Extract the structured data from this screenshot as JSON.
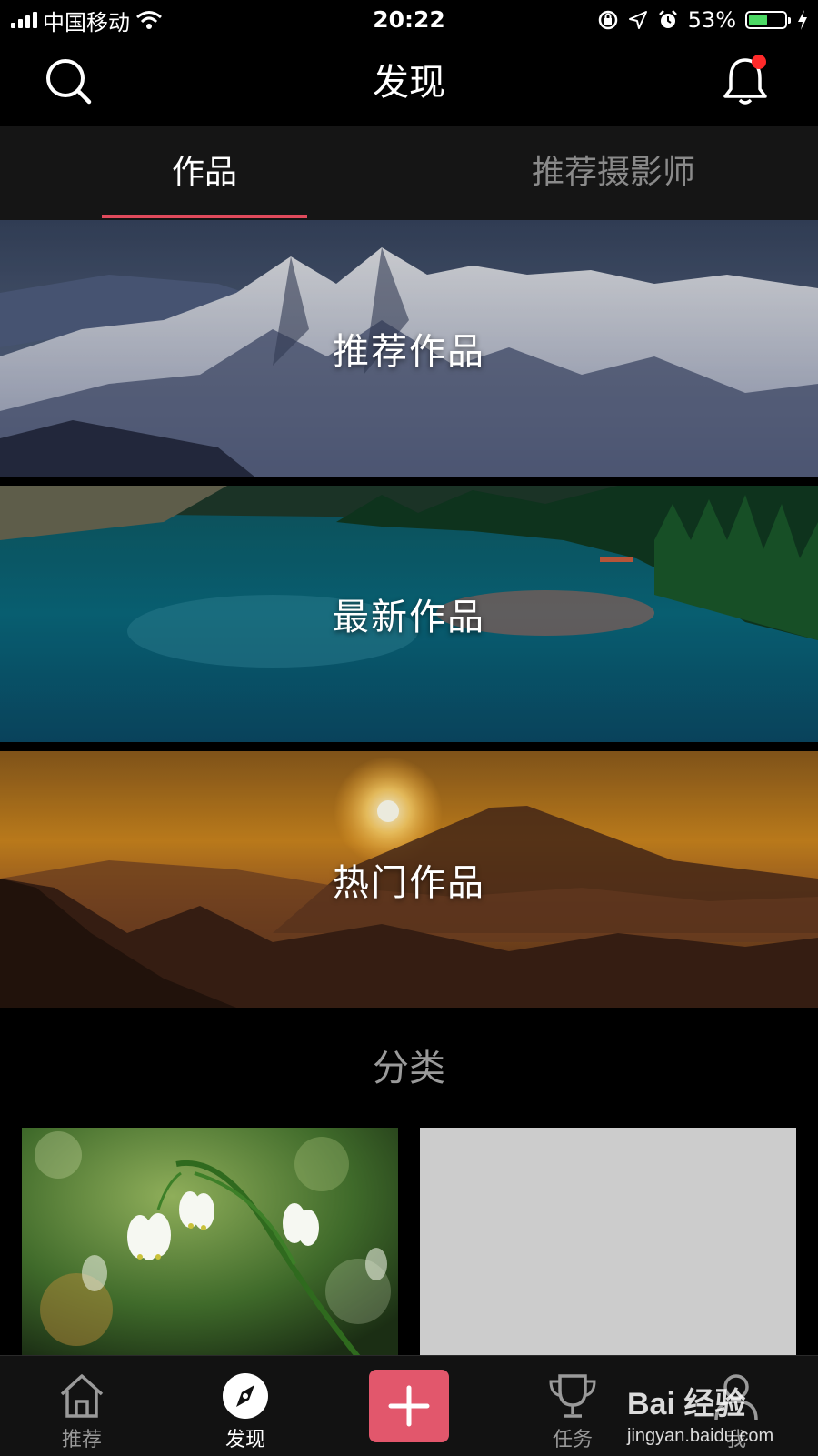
{
  "status_bar": {
    "carrier": "中国移动",
    "time": "20:22",
    "battery_percent": "53%",
    "battery_level": 0.53,
    "icons": [
      "signal-icon",
      "wifi-icon",
      "orientation-lock-icon",
      "location-icon",
      "alarm-icon",
      "battery-icon",
      "charging-icon"
    ]
  },
  "nav": {
    "title": "发现",
    "icons": [
      "search-icon",
      "bell-icon"
    ],
    "notification_dot_color": "#ff2a2a"
  },
  "tabs": [
    {
      "label": "作品",
      "active": true
    },
    {
      "label": "推荐摄影师",
      "active": false
    }
  ],
  "accent_color": "#e04a5c",
  "banners": [
    {
      "label": "推荐作品",
      "image": "snowy-mountains"
    },
    {
      "label": "最新作品",
      "image": "forest-lake"
    },
    {
      "label": "热门作品",
      "image": "sunset-mountain"
    }
  ],
  "category": {
    "title": "分类",
    "tiles": [
      {
        "image": "snowdrop-flowers"
      },
      {
        "image": "placeholder-gray"
      }
    ]
  },
  "bottom_tabs": [
    {
      "label": "推荐",
      "icon": "home-icon"
    },
    {
      "label": "发现",
      "icon": "compass-icon",
      "active": true
    },
    {
      "label": "",
      "icon": "plus-icon"
    },
    {
      "label": "任务",
      "icon": "trophy-icon"
    },
    {
      "label": "我",
      "icon": "user-icon"
    }
  ],
  "watermark": {
    "main": "Bai 经验",
    "sub": "jingyan.baidu.com"
  }
}
